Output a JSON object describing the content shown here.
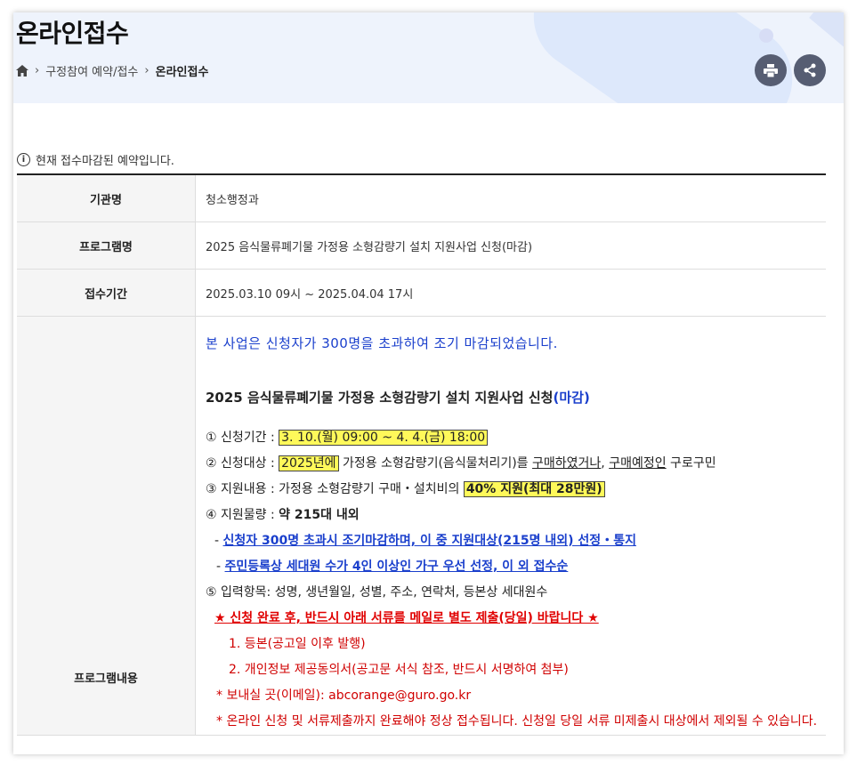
{
  "page": {
    "title": "온라인접수",
    "breadcrumb": [
      "구정참여 예약/접수",
      "온라인접수"
    ],
    "icons": {
      "home": "home-icon",
      "print": "print-icon",
      "share": "share-icon",
      "info": "info-icon"
    }
  },
  "notice": "현재 접수마감된 예약입니다.",
  "table": {
    "agency_label": "기관명",
    "agency_value": "청소행정과",
    "program_label": "프로그램명",
    "program_value": "2025 음식물류폐기물 가정용 소형감량기 설치 지원사업 신청(마감)",
    "period_label": "접수기간",
    "period_value": "2025.03.10 09시 ~ 2025.04.04 17시",
    "content_label": "프로그램내용"
  },
  "content": {
    "closed_notice": "본 사업은 신청자가 300명을 초과하여 조기 마감되었습니다.",
    "heading_main": "2025 음식물류폐기물 가정용 소형감량기 설치 지원사업 신청",
    "heading_tag": "(마감)",
    "item1_label": "① 신청기간 : ",
    "item1_value": "3. 10.(월) 09:00 ~ 4. 4.(금) 18:00",
    "item2_label": "② 신청대상 : ",
    "item2_year": "2025년에",
    "item2_mid": " 가정용 소형감량기(음식물처리기)를 ",
    "item2_u1": "구매하였거나",
    "item2_comma": ", ",
    "item2_u2": "구매예정인",
    "item2_end": " 구로구민",
    "item3_label": "③ 지원내용 : 가정용 소형감량기 구매・설치비의 ",
    "item3_value": "40% 지원(최대 28만원)",
    "item4_label": "④ 지원물량 : ",
    "item4_value": "약 215대 내외",
    "sub1_dash": "- ",
    "sub1": "신청자 300명 초과시 조기마감하며, 이 중 지원대상(215명 내외) 선정・통지",
    "sub2_dash": "- ",
    "sub2": "주민등록상 세대원 수가 4인 이상인 가구 우선 선정, 이 외 접수순",
    "item5": "⑤ 입력항목: 성명, 생년월일, 성별, 주소, 연락처, 등본상 세대원수",
    "warn": "★ 신청 완료 후, 반드시 아래 서류를 메일로 별도 제출(당일) 바랍니다 ★",
    "doc1": "1. 등본(공고일 이후 발행)",
    "doc2": "2. 개인정보 제공동의서(공고문 서식 참조, 반드시 서명하여 첨부)",
    "email": "* 보내실 곳(이메일): abcorange@guro.go.kr",
    "final_note": "* 온라인 신청 및 서류제출까지 완료해야 정상 접수됩니다. 신청일 당일 서류 미제출시 대상에서 제외될 수 있습니다."
  }
}
